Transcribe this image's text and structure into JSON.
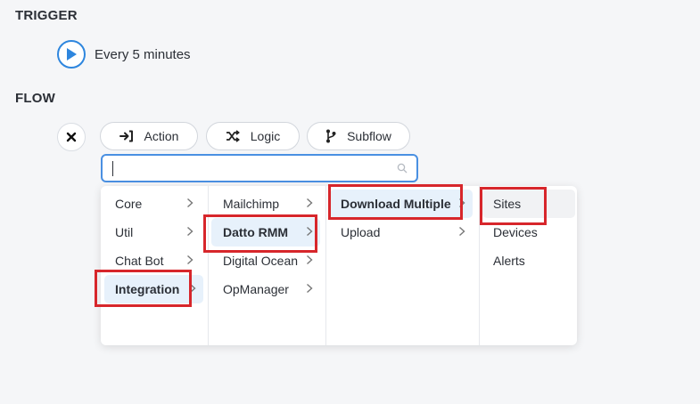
{
  "trigger": {
    "title": "TRIGGER",
    "text": "Every 5 minutes"
  },
  "flow": {
    "title": "FLOW",
    "buttons": {
      "action": "Action",
      "logic": "Logic",
      "subflow": "Subflow"
    }
  },
  "search": {
    "value": "",
    "placeholder": ""
  },
  "menu": {
    "col1": [
      "Core",
      "Util",
      "Chat Bot",
      "Integration"
    ],
    "col2": [
      "Mailchimp",
      "Datto RMM",
      "Digital Ocean",
      "OpManager"
    ],
    "col3": [
      "Download Multiple",
      "Upload"
    ],
    "col4": [
      "Sites",
      "Devices",
      "Alerts"
    ]
  },
  "colors": {
    "accent": "#2e86de",
    "highlight_box": "#d7262b",
    "active_bg": "#e7f1fb"
  }
}
